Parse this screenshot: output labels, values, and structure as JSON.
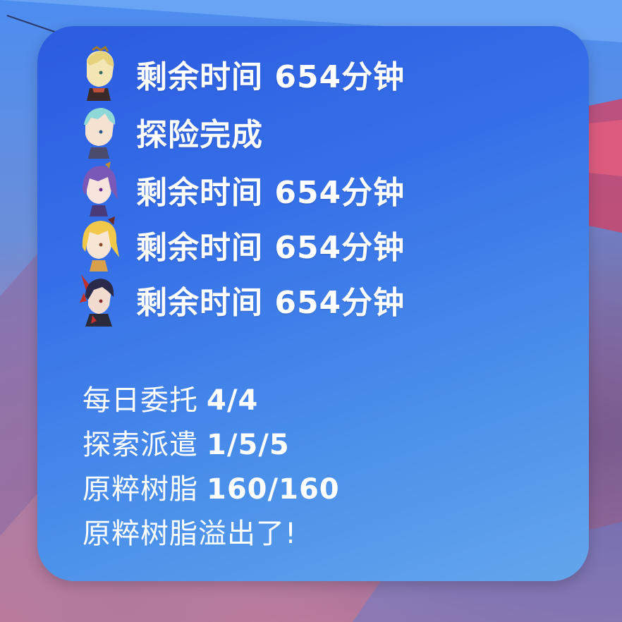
{
  "expeditions": [
    {
      "avatar": "blonde-character-avatar",
      "status": "剩余时间",
      "value": "654分钟"
    },
    {
      "avatar": "teal-hair-character-avatar",
      "status": "探险完成",
      "value": ""
    },
    {
      "avatar": "purple-hair-character-avatar",
      "status": "剩余时间",
      "value": "654分钟"
    },
    {
      "avatar": "yellow-hair-character-avatar",
      "status": "剩余时间",
      "value": "654分钟"
    },
    {
      "avatar": "red-black-character-avatar",
      "status": "剩余时间",
      "value": "654分钟"
    }
  ],
  "stats": {
    "daily_commissions": {
      "label": "每日委托",
      "value": "4/4"
    },
    "expedition_dispatch": {
      "label": "探索派遣",
      "value": "1/5/5"
    },
    "original_resin": {
      "label": "原粹树脂",
      "value": "160/160"
    },
    "resin_overflow": {
      "label": "原粹树脂溢出了!"
    }
  },
  "colors": {
    "widget_top": "#2b5be0",
    "widget_bottom": "#64a6ec",
    "text": "#ffffff"
  }
}
